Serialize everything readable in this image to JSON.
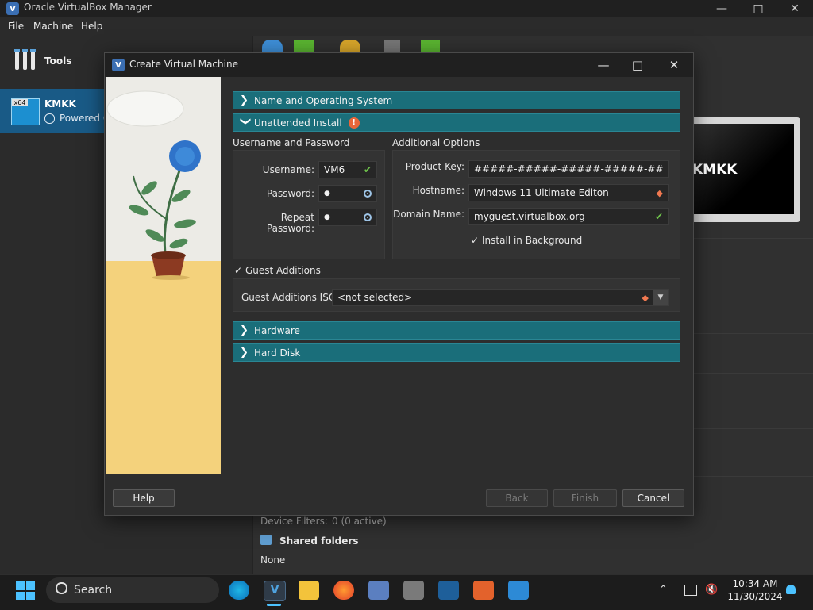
{
  "main_window": {
    "title": "Oracle VirtualBox Manager",
    "menu": [
      "File",
      "Machine",
      "Help"
    ],
    "tools_label": "Tools",
    "vm": {
      "arch_badge": "x64",
      "name": "KMKK",
      "state": "Powered Off"
    },
    "preview_label": "KMKK",
    "details": {
      "device_filters_label": "Device Filters:",
      "device_filters_value": "0 (0 active)",
      "shared_folders_label": "Shared folders",
      "shared_folders_value": "None"
    }
  },
  "dialog": {
    "title": "Create Virtual Machine",
    "sections": {
      "name_os": "Name and Operating System",
      "unattended": "Unattended Install",
      "hardware": "Hardware",
      "hard_disk": "Hard Disk"
    },
    "username_group": {
      "title": "Username and Password",
      "username_label": "Username:",
      "username_value": "VM6",
      "password_label": "Password:",
      "password_value": "●",
      "repeat_label": "Repeat Password:",
      "repeat_value": "●"
    },
    "additional_group": {
      "title": "Additional Options",
      "product_key_label": "Product Key:",
      "product_key_value": "#####-#####-#####-#####-#####",
      "hostname_label": "Hostname:",
      "hostname_value": "Windows 11 Ultimate Editon",
      "domain_label": "Domain Name:",
      "domain_value": "myguest.virtualbox.org",
      "install_bg_label": "Install in Background"
    },
    "guest_additions": {
      "checkbox_label": "Guest Additions",
      "iso_label": "Guest Additions ISO:",
      "iso_value": "<not selected>"
    },
    "buttons": {
      "help": "Help",
      "back": "Back",
      "finish": "Finish",
      "cancel": "Cancel"
    }
  },
  "taskbar": {
    "search_placeholder": "Search",
    "time": "10:34 AM",
    "date": "11/30/2024"
  }
}
